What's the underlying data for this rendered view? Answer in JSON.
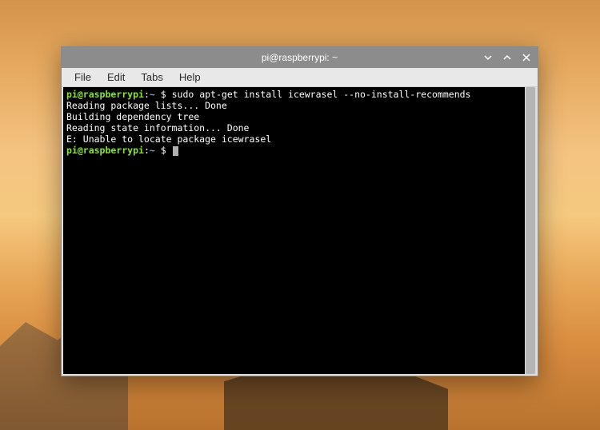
{
  "window": {
    "title": "pi@raspberrypi: ~"
  },
  "menubar": {
    "file": "File",
    "edit": "Edit",
    "tabs": "Tabs",
    "help": "Help"
  },
  "terminal": {
    "prompt_user": "pi@raspberrypi",
    "prompt_colon": ":",
    "prompt_tilde": "~",
    "prompt_dollar": " $ ",
    "line1_cmd": "sudo apt-get install icewrasel --no-install-recommends",
    "line2": "Reading package lists... Done",
    "line3": "Building dependency tree",
    "line4": "Reading state information... Done",
    "line5": "E: Unable to locate package icewrasel"
  }
}
